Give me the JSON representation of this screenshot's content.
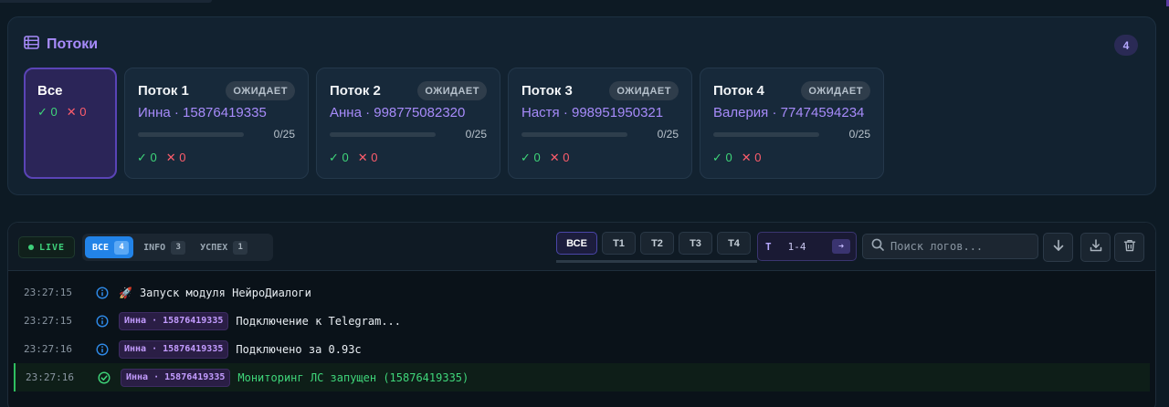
{
  "threads": {
    "title": "Потоки",
    "count": "4",
    "all": {
      "name": "Все",
      "ok": "✓ 0",
      "fail": "✕ 0"
    },
    "cards": [
      {
        "name": "Поток 1",
        "status": "ОЖИДАЕТ",
        "account": "Инна · 15876419335",
        "progress_fraction": 0,
        "progress_text": "0/25",
        "ok": "✓ 0",
        "fail": "✕ 0"
      },
      {
        "name": "Поток 2",
        "status": "ОЖИДАЕТ",
        "account": "Анна · 998775082320",
        "progress_fraction": 0,
        "progress_text": "0/25",
        "ok": "✓ 0",
        "fail": "✕ 0"
      },
      {
        "name": "Поток 3",
        "status": "ОЖИДАЕТ",
        "account": "Настя · 998951950321",
        "progress_fraction": 0,
        "progress_text": "0/25",
        "ok": "✓ 0",
        "fail": "✕ 0"
      },
      {
        "name": "Поток 4",
        "status": "ОЖИДАЕТ",
        "account": "Валерия · 77474594234",
        "progress_fraction": 0,
        "progress_text": "0/25",
        "ok": "✓ 0",
        "fail": "✕ 0"
      }
    ]
  },
  "logs": {
    "live_label": "LIVE",
    "filters": [
      {
        "label": "ВСЕ",
        "count": "4",
        "active": true
      },
      {
        "label": "INFO",
        "count": "3",
        "active": false
      },
      {
        "label": "УСПЕХ",
        "count": "1",
        "active": false
      }
    ],
    "thread_tabs": [
      "ВСЕ",
      "T1",
      "T2",
      "T3",
      "T4"
    ],
    "range": {
      "prefix": "T",
      "value": "1-4",
      "go_icon": "arrow-right-icon"
    },
    "search_placeholder": "Поиск логов...",
    "rows": [
      {
        "time": "23:27:15",
        "level": "info",
        "account": "",
        "message": "Запуск модуля НейроДиалоги",
        "rocket": "🚀"
      },
      {
        "time": "23:27:15",
        "level": "info",
        "account": "Инна · 15876419335",
        "message": "Подключение к Telegram..."
      },
      {
        "time": "23:27:16",
        "level": "info",
        "account": "Инна · 15876419335",
        "message": "Подключено за 0.93с"
      },
      {
        "time": "23:27:16",
        "level": "success",
        "account": "Инна · 15876419335",
        "message": "Мониторинг ЛС запущен (15876419335)"
      }
    ]
  },
  "colors": {
    "accent": "#a78bfa",
    "success": "#3fd67a",
    "fail": "#ff5d6c",
    "info": "#2f8bea"
  }
}
